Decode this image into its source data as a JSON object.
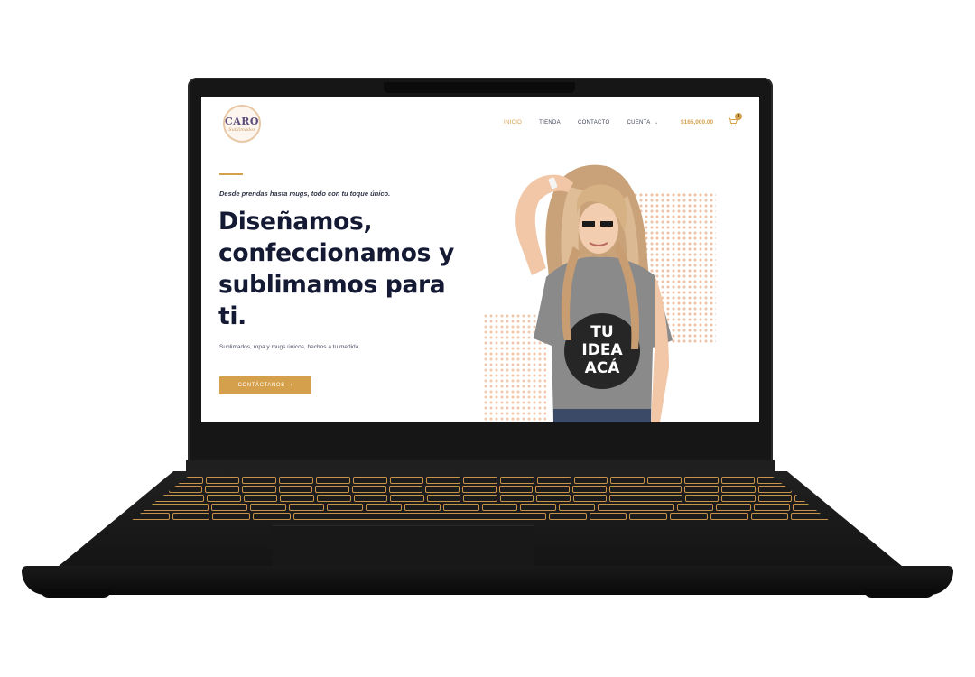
{
  "brand": {
    "name": "CARO",
    "subtitle": "Sublimados"
  },
  "nav": {
    "items": [
      {
        "label": "INICIO",
        "active": true
      },
      {
        "label": "TIENDA",
        "active": false
      },
      {
        "label": "CONTACTO",
        "active": false
      },
      {
        "label": "CUENTA",
        "active": false,
        "has_dropdown": true
      }
    ],
    "cart_total": "$165,000.00",
    "cart_count": "3"
  },
  "hero": {
    "tagline": "Desde prendas hasta mugs, todo con tu toque único.",
    "headline": "Diseñamos, confeccionamos y sublimamos para ti.",
    "subtext": "Sublimados, ropa y mugs únicos, hechos a tu medida.",
    "cta_label": "CONTÁCTANOS",
    "shirt_text": [
      "TU",
      "IDEA",
      "ACÁ"
    ]
  },
  "colors": {
    "accent": "#d4a04b",
    "headline": "#141a33",
    "dot_pattern": "#efc2a6",
    "laptop": "#161616"
  },
  "icons": [
    "cart-icon",
    "chevron-down-icon",
    "chevron-right-icon",
    "logo"
  ]
}
